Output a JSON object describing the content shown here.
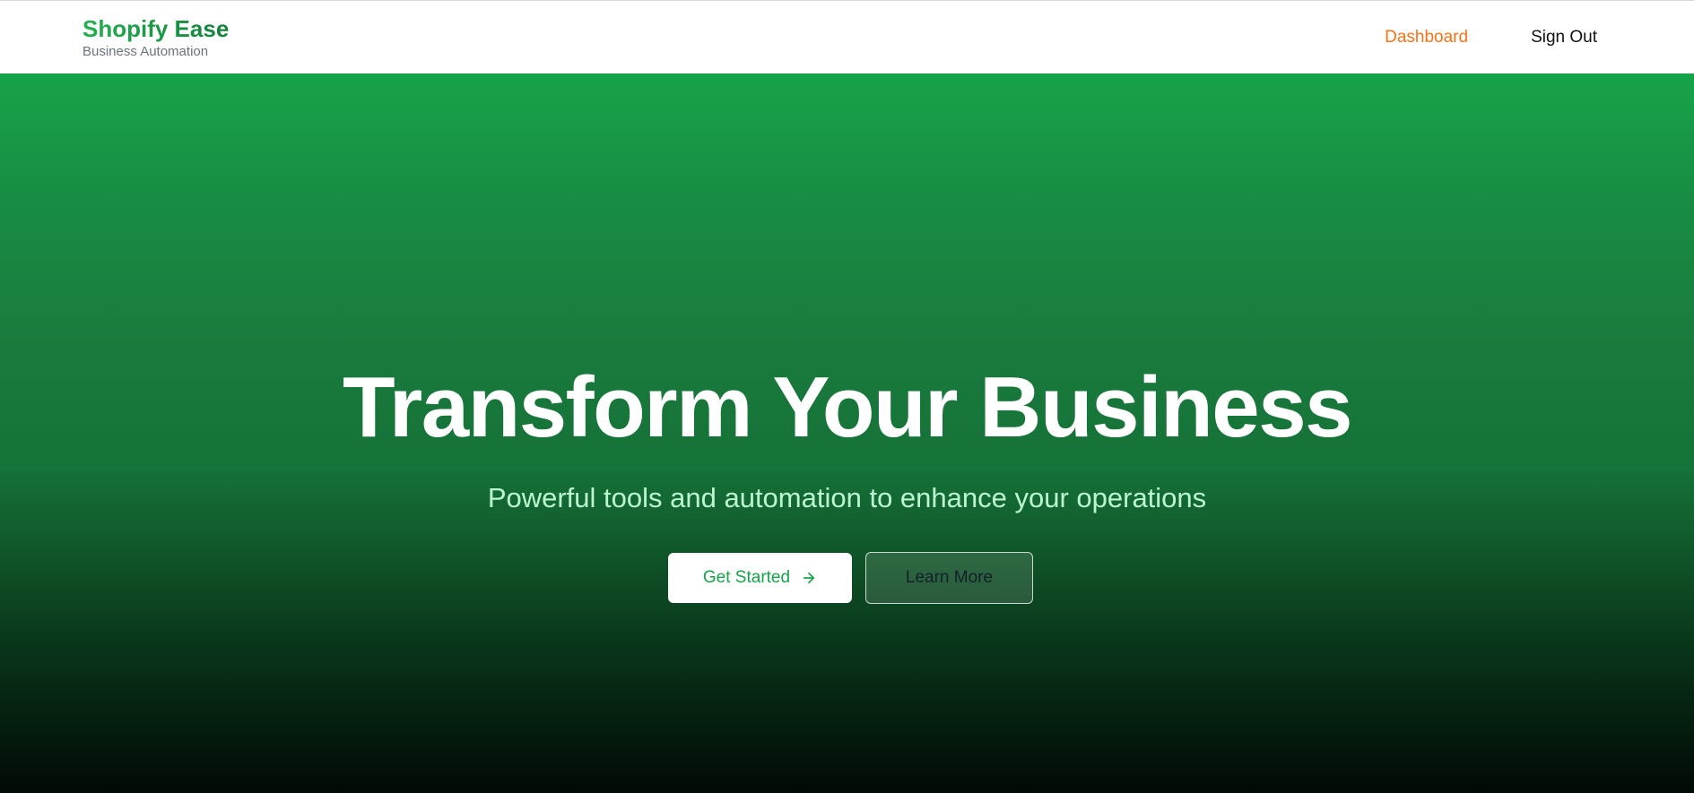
{
  "header": {
    "brand_name": "Shopify Ease",
    "brand_tagline": "Business Automation",
    "nav": {
      "dashboard": "Dashboard",
      "sign_out": "Sign Out"
    }
  },
  "hero": {
    "title": "Transform Your Business",
    "subtitle": "Powerful tools and automation to enhance your operations",
    "primary_button": "Get Started",
    "primary_button_icon": "arrow-right-icon",
    "secondary_button": "Learn More"
  },
  "colors": {
    "brand_green": "#16a34a",
    "nav_active": "#f97316",
    "subtitle_green": "#bbf7d0"
  }
}
